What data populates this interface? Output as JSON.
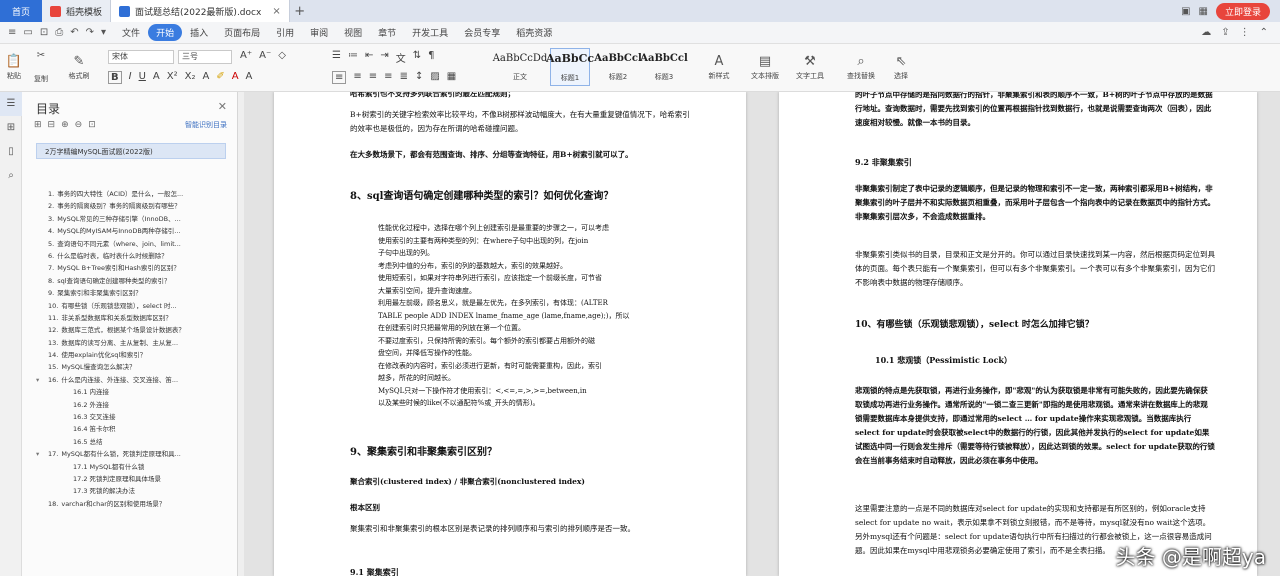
{
  "titlebar": {
    "home_label": "首页",
    "tab1_label": "稻壳模板",
    "tab2_label": "面试题总结(2022最新版).docx",
    "login_label": "立即登录"
  },
  "menubar": {
    "items": [
      "文件",
      "开始",
      "插入",
      "页面布局",
      "引用",
      "审阅",
      "视图",
      "章节",
      "开发工具",
      "会员专享",
      "稻壳资源"
    ],
    "active": "开始"
  },
  "ribbon": {
    "paste": "粘贴",
    "cut": "剪切",
    "copy": "复制",
    "format_painter": "格式刷",
    "font_name": "宋体",
    "font_size": "三号",
    "style_samples": [
      "AaBbCcDd",
      "AaBbCc",
      "AaBbCcl",
      "AaBbCcl"
    ],
    "style_labels": [
      "正文",
      "标题1",
      "标题2",
      "标题3"
    ],
    "new_style": "新样式",
    "text_tools": "文字工具",
    "find_replace": "查找替换",
    "select": "选择",
    "text_layout": "文本排版"
  },
  "toc": {
    "title": "目录",
    "smart_label": "智能识别目录",
    "selected": "2万字精编MySQL面试题(2022版)",
    "items": [
      {
        "level": 1,
        "num": "1.",
        "text": "事务的四大特性（ACID）是什么，一般怎...",
        "arrow": false
      },
      {
        "level": 1,
        "num": "2.",
        "text": "事务的隔离级别？事务的隔离级别有哪些？",
        "arrow": false
      },
      {
        "level": 1,
        "num": "3.",
        "text": "MySQL常见的三种存储引擎（InnoDB、...",
        "arrow": false
      },
      {
        "level": 1,
        "num": "4.",
        "text": "MySQL的MyISAM与InnoDB两种存储引...",
        "arrow": false
      },
      {
        "level": 1,
        "num": "5.",
        "text": "查询语句不同元素（where、join、limit...",
        "arrow": false
      },
      {
        "level": 1,
        "num": "6.",
        "text": "什么是临时表，临时表什么时候删除？",
        "arrow": false
      },
      {
        "level": 1,
        "num": "7.",
        "text": "MySQL B+Tree索引和Hash索引的区别？",
        "arrow": false
      },
      {
        "level": 1,
        "num": "8.",
        "text": "sql查询语句确定创建哪种类型的索引？",
        "arrow": false
      },
      {
        "level": 1,
        "num": "9.",
        "text": "聚集索引和非聚集索引区别？",
        "arrow": false
      },
      {
        "level": 1,
        "num": "10.",
        "text": "有哪些锁（乐观锁悲观锁），select 时...",
        "arrow": false
      },
      {
        "level": 1,
        "num": "11.",
        "text": "非关系型数据库和关系型数据库区别？",
        "arrow": false
      },
      {
        "level": 1,
        "num": "12.",
        "text": "数据库三范式，根据某个场景设计数据表？",
        "arrow": false
      },
      {
        "level": 1,
        "num": "13.",
        "text": "数据库的读写分离、主从复制、主从复...",
        "arrow": false
      },
      {
        "level": 1,
        "num": "14.",
        "text": "使用explain优化sql和索引？",
        "arrow": false
      },
      {
        "level": 1,
        "num": "15.",
        "text": "MySQL慢查询怎么解决？",
        "arrow": false
      },
      {
        "level": 1,
        "num": "16.",
        "text": "什么是内连接、外连接、交叉连接、笛...",
        "arrow": true
      },
      {
        "level": 2,
        "num": "",
        "text": "16.1 内连接",
        "arrow": false
      },
      {
        "level": 2,
        "num": "",
        "text": "16.2 外连接",
        "arrow": false
      },
      {
        "level": 2,
        "num": "",
        "text": "16.3 交叉连接",
        "arrow": false
      },
      {
        "level": 2,
        "num": "",
        "text": "16.4 笛卡尔积",
        "arrow": false
      },
      {
        "level": 2,
        "num": "",
        "text": "16.5 总结",
        "arrow": false
      },
      {
        "level": 1,
        "num": "17.",
        "text": "MySQL都有什么锁，死锁判定原理和具...",
        "arrow": true
      },
      {
        "level": 2,
        "num": "",
        "text": "17.1 MySQL都有什么锁",
        "arrow": false
      },
      {
        "level": 2,
        "num": "",
        "text": "17.2 死锁判定原理和具体场景",
        "arrow": false
      },
      {
        "level": 2,
        "num": "",
        "text": "17.3 死锁的解决办法",
        "arrow": false
      },
      {
        "level": 1,
        "num": "18.",
        "text": "varchar和char的区别和使用场景？",
        "arrow": false
      }
    ]
  },
  "page1": {
    "p0": "哈希索引也不支持多列联合索引的最左匹配规则；",
    "p1": "B+树索引的关键字检索效率比较平均，不像B树那样波动幅度大，在有大量重复键值情况下，哈希索引的效率也是极低的，因为存在所谓的哈希碰撞问题。",
    "p2": "在大多数场景下，都会有范围查询、排序、分组等查询特征，用B+树索引就可以了。",
    "h8": "8、sql查询语句确定创建哪种类型的索引？如何优化查询？",
    "bullets": [
      "性能优化过程中，选择在哪个列上创建索引是最重要的步骤之一，可以考虑",
      "使用索引的主要有两种类型的列：在where子句中出现的列，在join",
      "子句中出现的列。",
      "考虑列中值的分布，索引的列的基数越大，索引的效果越好。",
      "使用短索引，如果对字符串列进行索引，应该指定一个前缀长度，可节省",
      "大量索引空间，提升查询速度。",
      "利用最左前缀，顾名思义，就是最左优先，在多列索引，有体现：(ALTER",
      "TABLE people ADD INDEX lname_fname_age (lame,fname,age);)，所以",
      "在创建索引时只把最常用的列放在第一个位置。",
      "不要过度索引，只保持所需的索引。每个额外的索引都要占用额外的磁",
      "盘空间，并降低写操作的性能。",
      "在修改表的内容时，索引必须进行更新，有时可能需要重构，因此，索引",
      "越多，所花的时间越长。",
      "MySQL只对一下操作符才使用索引：<,<=,=,>,>=,between,in",
      "以及某些时候的like(不以通配符%或_开头的情形)。"
    ],
    "h9": "9、聚集索引和非聚集索引区别？",
    "s9": "聚合索引(clustered index) / 非聚合索引(nonclustered index)",
    "root": "根本区别",
    "p3": "聚集索引和非聚集索引的根本区别是表记录的排列顺序和与索引的排列顺序是否一致。",
    "s91": "9.1 聚集索引"
  },
  "page2": {
    "p0": "的叶子节点中存储的是指向数据行的指针，非聚集索引和表的顺序不一致，B+树的叶子节点中存放的是数据行地址。查询数据时，需要先找到索引的位置再根据指针找到数据行，也就是说需要查询两次（回表），因此速度相对较慢。就像一本书的目录。",
    "h92": "9.2 非聚集索引",
    "p1": "非聚集索引制定了表中记录的逻辑顺序，但是记录的物理和索引不一定一致，两种索引都采用B+树结构，非聚集索引的叶子层并不和实际数据页相重叠，而采用叶子层包含一个指向表中的记录在数据页中的指针方式。非聚集索引层次多，不会造成数据重排。",
    "p2": "非聚集索引类似书的目录，目录和正文是分开的。你可以通过目录快速找到某一内容，然后根据页码定位到具体的页面。每个表只能有一个聚集索引，但可以有多个非聚集索引。一个表可以有多个非聚集索引，因为它们不影响表中数据的物理存储顺序。",
    "h10": "10、有哪些锁（乐观锁悲观锁），select 时怎么加排它锁？",
    "s101": "10.1 悲观锁（Pessimistic Lock）",
    "p3": "悲观锁的特点是先获取锁，再进行业务操作，即\"悲观\"的认为获取锁是非常有可能失败的，因此要先确保获取锁成功再进行业务操作。通常所说的\"一锁二查三更新\"即指的是使用悲观锁。通常来讲在数据库上的悲观锁需要数据库本身提供支持，即通过常用的select … for update操作来实现悲观锁。当数据库执行select for update时会获取被select中的数据行的行锁，因此其他并发执行的select for update如果试图选中同一行则会发生排斥（需要等待行锁被释放），因此达到锁的效果。select for update获取的行锁会在当前事务结束时自动释放，因此必须在事务中使用。",
    "p4": "这里需要注意的一点是不同的数据库对select for update的实现和支持都是有所区别的，例如oracle支持select for update no wait，表示如果拿不到锁立刻报错，而不是等待，mysql就没有no wait这个选项。另外mysql还有个问题是：select for update语句执行中所有扫描过的行都会被锁上，这一点很容易造成问题。因此如果在mysql中用悲观锁务必要确定使用了索引，而不是全表扫描。"
  },
  "watermark": "头条 @是啊超ya"
}
